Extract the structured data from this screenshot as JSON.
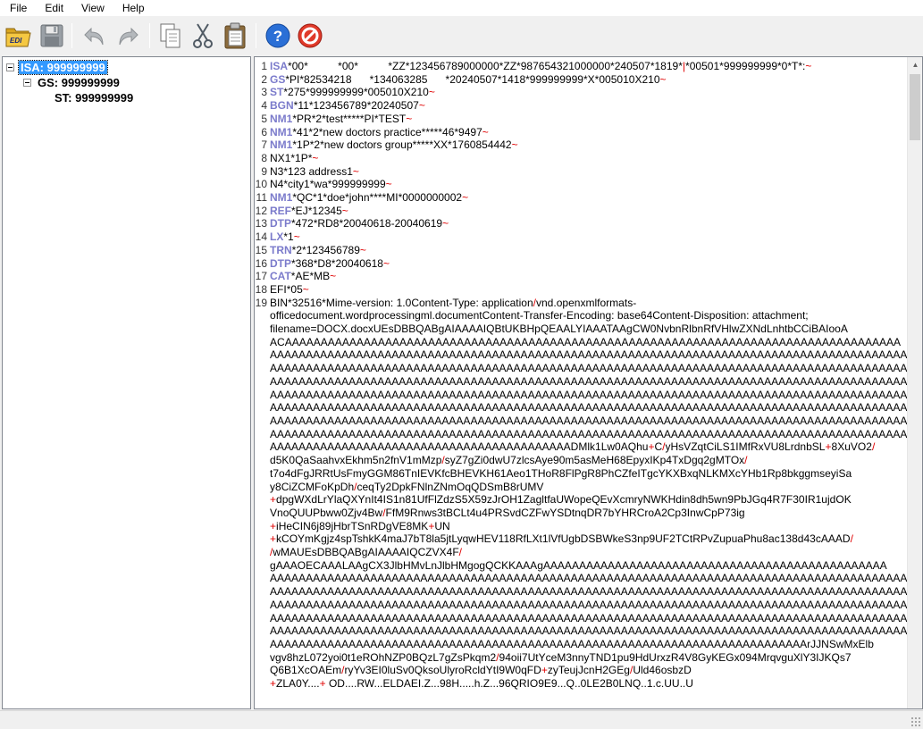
{
  "menu": [
    "File",
    "Edit",
    "View",
    "Help"
  ],
  "toolbar": {
    "icons": [
      "open-edi-icon",
      "save-icon",
      "undo-icon",
      "redo-icon",
      "copy-icon",
      "cut-icon",
      "paste-icon",
      "help-icon",
      "stop-icon"
    ],
    "open_label": "EDI"
  },
  "tree": {
    "isa": "ISA: 999999999",
    "gs": "GS: 999999999",
    "st": "ST: 999999999"
  },
  "colors": {
    "segment": "#7b7bcb",
    "delimiter": "#e00000",
    "selection": "#3399ff"
  },
  "editor": {
    "lines": [
      {
        "n": "1",
        "seg": "ISA",
        "text": "*00*          *00*          *ZZ*123456789000000*ZZ*987654321000000*240507*1819*|*00501*999999999*0*T*:~"
      },
      {
        "n": "2",
        "seg": "GS",
        "text": "*PI*82534218      *134063285      *20240507*1418*999999999*X*005010X210~"
      },
      {
        "n": "3",
        "seg": "ST",
        "text": "*275*999999999*005010X210~"
      },
      {
        "n": "4",
        "seg": "BGN",
        "text": "*11*123456789*20240507~"
      },
      {
        "n": "5",
        "seg": "NM1",
        "text": "*PR*2*test*****PI*TEST~"
      },
      {
        "n": "6",
        "seg": "NM1",
        "text": "*41*2*new doctors practice*****46*9497~"
      },
      {
        "n": "7",
        "seg": "NM1",
        "text": "*1P*2*new doctors group*****XX*1760854442~"
      },
      {
        "n": "8",
        "seg": "",
        "text": "NX1*1P*~"
      },
      {
        "n": "9",
        "seg": "",
        "text": "N3*123 address1~"
      },
      {
        "n": "10",
        "seg": "",
        "text": "N4*city1*wa*999999999~"
      },
      {
        "n": "11",
        "seg": "NM1",
        "text": "*QC*1*doe*john****MI*0000000002~"
      },
      {
        "n": "12",
        "seg": "REF",
        "text": "*EJ*12345~"
      },
      {
        "n": "13",
        "seg": "DTP",
        "text": "*472*RD8*20040618-20040619~"
      },
      {
        "n": "14",
        "seg": "LX",
        "text": "*1~"
      },
      {
        "n": "15",
        "seg": "TRN",
        "text": "*2*123456789~"
      },
      {
        "n": "16",
        "seg": "DTP",
        "text": "*368*D8*20040618~"
      },
      {
        "n": "17",
        "seg": "CAT",
        "text": "*AE*MB~"
      },
      {
        "n": "18",
        "seg": "",
        "text": "EFI*05~"
      }
    ],
    "bin_number": "19",
    "bin_rows": [
      "BIN*32516*Mime-version: 1.0Content-Type: application/vnd.openxmlformats-",
      "officedocument.wordprocessingml.documentContent-Transfer-Encoding: base64Content-Disposition: attachment;",
      "filename=DOCX.docxUEsDBBQABgAIAAAAIQBtUKBHpQEAALYIAAATAAgCW0NvbnRlbnRfVHlwZXNdLnhtbCCiBAIooA",
      "ACAAAAAAAAAAAAAAAAAAAAAAAAAAAAAAAAAAAAAAAAAAAAAAAAAAAAAAAAAAAAAAAAAAAAAAAAAAAAAAAAAAAAAA",
      "AAAAAAAAAAAAAAAAAAAAAAAAAAAAAAAAAAAAAAAAAAAAAAAAAAAAAAAAAAAAAAAAAAAAAAAAAAAAAAAAAAAAAAAAA",
      "AAAAAAAAAAAAAAAAAAAAAAAAAAAAAAAAAAAAAAAAAAAAAAAAAAAAAAAAAAAAAAAAAAAAAAAAAAAAAAAAAAAAAAAAA",
      "AAAAAAAAAAAAAAAAAAAAAAAAAAAAAAAAAAAAAAAAAAAAAAAAAAAAAAAAAAAAAAAAAAAAAAAAAAAAAAAAAAAAAAAAA",
      "AAAAAAAAAAAAAAAAAAAAAAAAAAAAAAAAAAAAAAAAAAAAAAAAAAAAAAAAAAAAAAAAAAAAAAAAAAAAAAAAAAAAAAAAA",
      "AAAAAAAAAAAAAAAAAAAAAAAAAAAAAAAAAAAAAAAAAAAAAAAAAAAAAAAAAAAAAAAAAAAAAAAAAAAAAAAAAAAAAAAAA",
      "AAAAAAAAAAAAAAAAAAAAAAAAAAAAAAAAAAAAAAAAAAAAAAAAAAAAAAAAAAAAAAAAAAAAAAAAAAAAAAAAAAAAAAAAA",
      "AAAAAAAAAAAAAAAAAAAAAAAAAAAAAAAAAAAAAAAAAAAAAAAAAAAAAAAAAAAAAAAAAAAAAAAAAAAAAAAAAAAAAAAAA",
      "AAAAAAAAAAAAAAAAAAAAAAAAAAAAAAAAAAAAAAAAAADMlk1Lw0AQhu+C/yHsVZqtCiLS1IMfRxVU8LrdnbSL+8XuVO2/",
      "d5K0QaSaahvxEkhm5n2fnV1mMzp/syZ7gZi0dwU7zlcsAye90m5asMeH68EpyxIKp4TxDgq2gMTOx/",
      "t7o4dFgJRRtUsFmyGGM86TnIEVKfcBHEVKH61Aeo1THoR8FlPgR8PhCZfeITgcYKXBxqNLKMXcYHb1Rp8bkggmseyiSa",
      "y8CiZCMFoKpDh/ceqTy2DpkFNlnZNmOqQDSmB8rUMV",
      "+dpgWXdLrYlaQXYnIt4IS1n81UfFlZdzS5X59zJrOH1ZagltfaUWopeQEvXcmryNWKHdin8dh5wn9PbJGq4R7F30IR1ujdOK",
      "VnoQUUPbww0Zjv4Bw/FfM9Rnws3tBCLt4u4PRSvdCZFwYSDtnqDR7bYHRCroA2Cp3InwCpP73ig",
      "+iHeCIN6j89jHbrTSnRDgVE8MK+UN",
      "+kCOYmKgjz4spTshkK4maJ7bT8la5jtLyqwHEV118RfLXt1lVfUgbDSBWkeS3np9UF2TCtRPvZupuaPhu8ac138d43cAAAD/",
      "/wMAUEsDBBQABgAIAAAAIQCZVX4F/",
      "gAAAOECAAALAAgCX3JlbHMvLnJlbHMgogQCKKAAAgAAAAAAAAAAAAAAAAAAAAAAAAAAAAAAAAAAAAAAAAAAAAAAAA",
      "AAAAAAAAAAAAAAAAAAAAAAAAAAAAAAAAAAAAAAAAAAAAAAAAAAAAAAAAAAAAAAAAAAAAAAAAAAAAAAAAAAAAAAAAA",
      "AAAAAAAAAAAAAAAAAAAAAAAAAAAAAAAAAAAAAAAAAAAAAAAAAAAAAAAAAAAAAAAAAAAAAAAAAAAAAAAAAAAAAAAAA",
      "AAAAAAAAAAAAAAAAAAAAAAAAAAAAAAAAAAAAAAAAAAAAAAAAAAAAAAAAAAAAAAAAAAAAAAAAAAAAAAAAAAAAAAAAA",
      "AAAAAAAAAAAAAAAAAAAAAAAAAAAAAAAAAAAAAAAAAAAAAAAAAAAAAAAAAAAAAAAAAAAAAAAAAAAAAAAAAAAAAAAAA",
      "AAAAAAAAAAAAAAAAAAAAAAAAAAAAAAAAAAAAAAAAAAAAAAAAAAAAAAAAAAAAAAAAAAAAAAAAAAAAAAAAAAAAAAAAA",
      "AAAAAAAAAAAAAAAAAAAAAAAAAAAAAAAAAAAAAAAAAAAAAAAAAAAAAAAAAAAAAAAAAAAAAAAAAAArJJNSwMxElb",
      "vgv8hzL072yoi0t1eROhNZP0BQzL7gZsPkqm2/94oii7UtYceM3nnyTND1pu9HdUrxzR4V8GyKEGx094MrqvguXlY3IJKQs7",
      "Q6B1XcOAEm/ryYv3EI0luSv0QksoUlyroRcldYtI9W0qFD+zyTeujJcnH2GEg/Uld46osbzD",
      "+ZLA0Y....+ OD....RW...ELDAEI.Z...98H.....h.Z...96QRIO9E9...Q..0LE2B0LNQ..1.c.UU..U"
    ]
  }
}
